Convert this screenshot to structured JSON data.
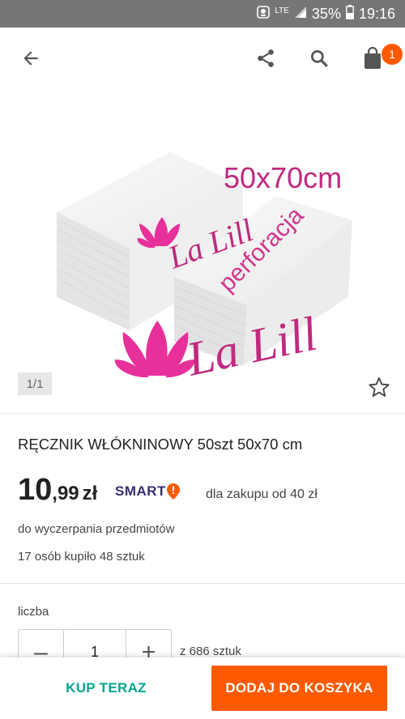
{
  "status_bar": {
    "network": "LTE",
    "battery": "35%",
    "time": "19:16"
  },
  "app_bar": {
    "cart_count": "1",
    "icons": [
      "back-arrow-icon",
      "share-icon",
      "search-icon",
      "shopping-bag-icon"
    ]
  },
  "gallery": {
    "counter": "1/1",
    "image_text": {
      "size": "50x70cm",
      "brand_small": "La Lill",
      "perforation": "perforacja",
      "brand_large": "La Lill"
    }
  },
  "product": {
    "title": "RĘCZNIK WŁÓKNINOWY 50szt 50x70 cm",
    "price_int": "10",
    "price_dec": ",99",
    "currency": "zł",
    "smart_label": "SMART",
    "smart_note": "dla zakupu od 40 zł",
    "availability": "do wyczerpania przedmiotów",
    "sold": "17 osób kupiło 48 sztuk"
  },
  "quantity": {
    "label": "liczba",
    "minus": "–",
    "value": "1",
    "plus": "+",
    "stock": "z 686 sztuk"
  },
  "actions": {
    "buy_now": "KUP TERAZ",
    "add_to_cart": "DODAJ DO KOSZYKA"
  },
  "colors": {
    "accent": "#ff5a00",
    "teal": "#00a790",
    "smart": "#3a2d73",
    "lotus": "#e8309a"
  }
}
